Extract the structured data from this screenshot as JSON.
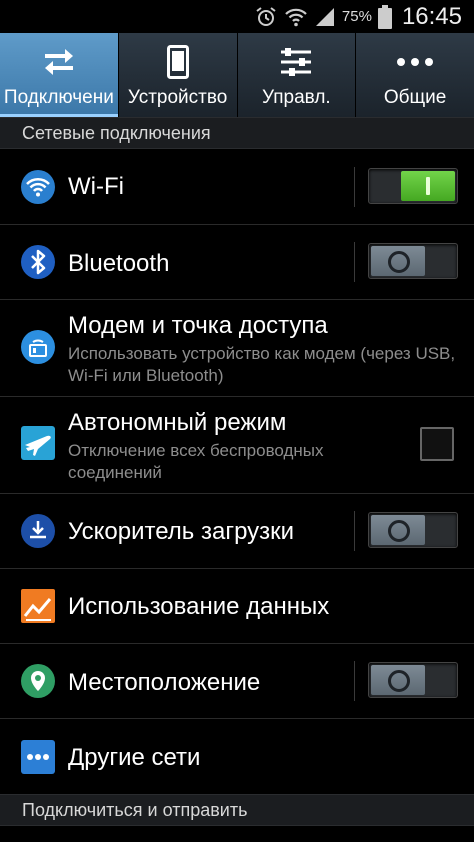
{
  "status_bar": {
    "icons": [
      "alarm-icon",
      "wifi-icon",
      "signal-icon",
      "battery-icon"
    ],
    "battery": "75%",
    "time": "16:45"
  },
  "tabs": [
    {
      "label": "Подключени",
      "icon": "swap-arrows-icon",
      "active": true
    },
    {
      "label": "Устройство",
      "icon": "phone-icon",
      "active": false
    },
    {
      "label": "Управл.",
      "icon": "sliders-icon",
      "active": false
    },
    {
      "label": "Общие",
      "icon": "more-dots-icon",
      "active": false
    }
  ],
  "sections": [
    {
      "title": "Сетевые подключения"
    },
    {
      "title": "Подключиться и отправить"
    }
  ],
  "settings": [
    {
      "title": "Wi-Fi",
      "icon": "wifi-icon",
      "control": "toggle",
      "state": "on"
    },
    {
      "title": "Bluetooth",
      "icon": "bluetooth-icon",
      "control": "toggle",
      "state": "off"
    },
    {
      "title": "Модем и точка доступа",
      "subtitle": "Использовать устройство как модем (через USB, Wi-Fi или Bluetooth)",
      "icon": "hotspot-icon",
      "control": "none"
    },
    {
      "title": "Автономный режим",
      "subtitle": "Отключение всех беспроводных соединений",
      "icon": "airplane-icon",
      "control": "checkbox",
      "state": "unchecked"
    },
    {
      "title": "Ускоритель загрузки",
      "icon": "download-booster-icon",
      "control": "toggle",
      "state": "off"
    },
    {
      "title": "Использование данных",
      "icon": "data-usage-icon",
      "control": "none"
    },
    {
      "title": "Местоположение",
      "icon": "location-icon",
      "control": "toggle",
      "state": "off"
    },
    {
      "title": "Другие сети",
      "icon": "more-networks-icon",
      "control": "none"
    }
  ],
  "colors": {
    "active_tab": "#4a88ba",
    "toggle_on": "#5cbf34",
    "toggle_off": "#6b7782",
    "subtitle_text": "#8d8d8d"
  }
}
